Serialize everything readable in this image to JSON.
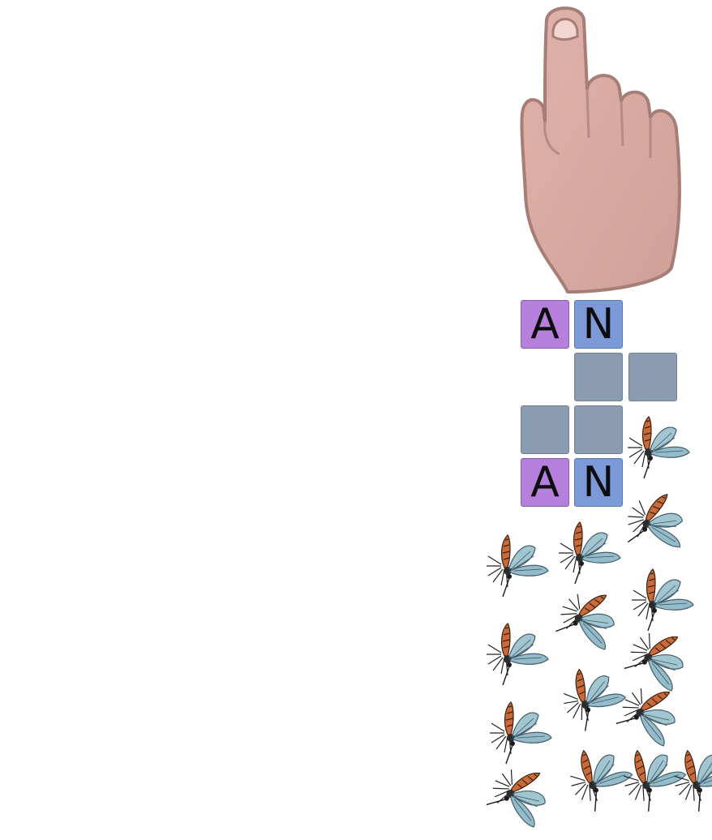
{
  "game": {
    "pointer_icon": "pointing-hand-icon",
    "tile_colors": {
      "purple": "#b57fdc",
      "blue": "#7d9ad8",
      "empty": "#8b9bb0"
    },
    "grid": {
      "row1": [
        "A",
        "N"
      ],
      "row4": [
        "A",
        "N"
      ]
    },
    "creature_icon": "mosquito-icon",
    "creature_count": 18
  }
}
